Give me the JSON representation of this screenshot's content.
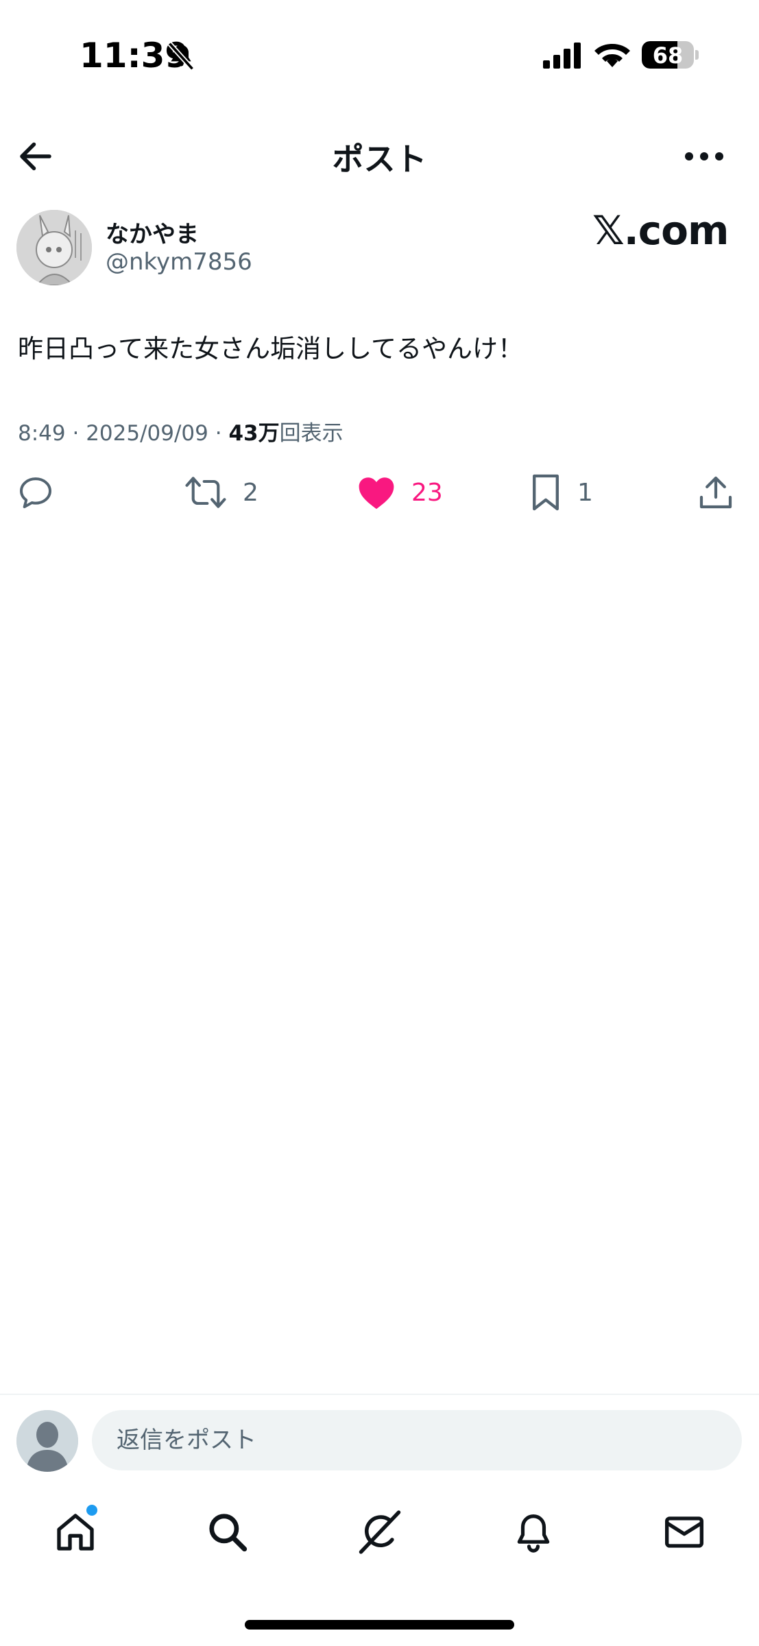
{
  "status_bar": {
    "time": "11:39",
    "battery_level": "68",
    "battery_fraction": 0.68,
    "icons": [
      "bell-slash-icon",
      "signal-icon",
      "wifi-icon",
      "battery-icon"
    ]
  },
  "header": {
    "title": "ポスト",
    "back_icon": "arrow-left-icon",
    "more_icon": "more-horizontal-icon"
  },
  "post": {
    "author_name": "なかやま",
    "author_handle": "@nkym7856",
    "source_badge": "𝕏.com",
    "text": "昨日凸って来た女さん垢消ししてるやんけ！",
    "time": "8:49",
    "date": "2025/09/09",
    "separator": "·",
    "views_count": "43万",
    "views_label": "回表示"
  },
  "actions": {
    "reply": {
      "icon": "reply-icon",
      "count": ""
    },
    "repost": {
      "icon": "repost-icon",
      "count": "2"
    },
    "like": {
      "icon": "heart-filled-icon",
      "count": "23",
      "color": "#f91880"
    },
    "bookmark": {
      "icon": "bookmark-icon",
      "count": "1"
    },
    "share": {
      "icon": "share-icon"
    }
  },
  "reply_bar": {
    "placeholder": "返信をポスト"
  },
  "tab_bar": {
    "tabs": [
      {
        "name": "home",
        "icon": "home-icon",
        "has_badge": true
      },
      {
        "name": "search",
        "icon": "search-icon"
      },
      {
        "name": "grok",
        "icon": "grok-icon"
      },
      {
        "name": "notifications",
        "icon": "bell-icon"
      },
      {
        "name": "messages",
        "icon": "mail-icon"
      }
    ]
  },
  "colors": {
    "text": "#0f1419",
    "secondary": "#536471",
    "like": "#f91880",
    "badge": "#1d9bf0",
    "input_bg": "#eff3f4"
  }
}
